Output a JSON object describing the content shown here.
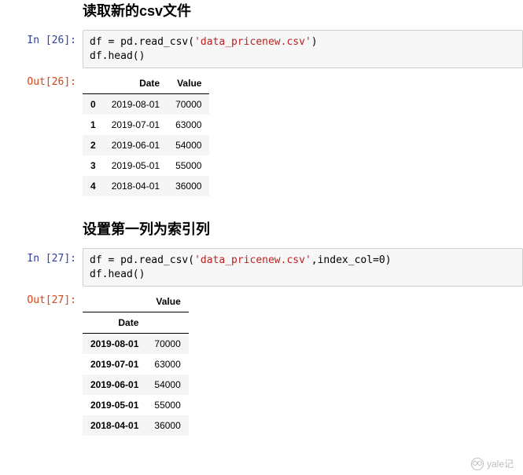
{
  "sections": [
    {
      "heading": "读取新的csv文件",
      "in_label": "In [26]:",
      "out_label": "Out[26]:",
      "code_prefix1": "df = pd.read_csv(",
      "code_str1": "'data_pricenew.csv'",
      "code_suffix1": ")",
      "code_line2": "df.head()",
      "table": {
        "columns": [
          "Date",
          "Value"
        ],
        "index_name": "",
        "rows": [
          {
            "idx": "0",
            "cells": [
              "2019-08-01",
              "70000"
            ]
          },
          {
            "idx": "1",
            "cells": [
              "2019-07-01",
              "63000"
            ]
          },
          {
            "idx": "2",
            "cells": [
              "2019-06-01",
              "54000"
            ]
          },
          {
            "idx": "3",
            "cells": [
              "2019-05-01",
              "55000"
            ]
          },
          {
            "idx": "4",
            "cells": [
              "2018-04-01",
              "36000"
            ]
          }
        ]
      }
    },
    {
      "heading": "设置第一列为索引列",
      "in_label": "In [27]:",
      "out_label": "Out[27]:",
      "code_prefix1": "df = pd.read_csv(",
      "code_str1": "'data_pricenew.csv'",
      "code_suffix1": ",index_col=0)",
      "code_line2": "df.head()",
      "table": {
        "columns": [
          "Value"
        ],
        "index_name": "Date",
        "rows": [
          {
            "idx": "2019-08-01",
            "cells": [
              "70000"
            ]
          },
          {
            "idx": "2019-07-01",
            "cells": [
              "63000"
            ]
          },
          {
            "idx": "2019-06-01",
            "cells": [
              "54000"
            ]
          },
          {
            "idx": "2019-05-01",
            "cells": [
              "55000"
            ]
          },
          {
            "idx": "2018-04-01",
            "cells": [
              "36000"
            ]
          }
        ]
      }
    }
  ],
  "watermark": "yale记"
}
